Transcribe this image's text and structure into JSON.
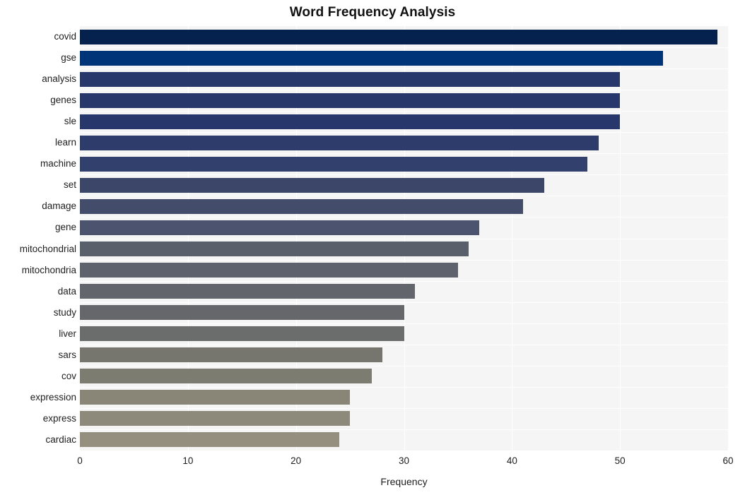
{
  "chart_data": {
    "type": "bar",
    "orientation": "horizontal",
    "title": "Word Frequency Analysis",
    "xlabel": "Frequency",
    "ylabel": "",
    "categories": [
      "covid",
      "gse",
      "analysis",
      "genes",
      "sle",
      "learn",
      "machine",
      "set",
      "damage",
      "gene",
      "mitochondrial",
      "mitochondria",
      "data",
      "study",
      "liver",
      "sars",
      "cov",
      "expression",
      "express",
      "cardiac"
    ],
    "values": [
      59,
      54,
      50,
      50,
      50,
      48,
      47,
      43,
      41,
      37,
      36,
      35,
      31,
      30,
      30,
      28,
      27,
      25,
      25,
      24
    ],
    "xlim": [
      0,
      60
    ],
    "xticks": [
      0,
      10,
      20,
      30,
      40,
      50,
      60
    ],
    "xtick_labels": [
      "0",
      "10",
      "20",
      "30",
      "40",
      "50",
      "60"
    ],
    "grid": true,
    "legend": false,
    "bar_colors": [
      "#04224d",
      "#003478",
      "#27376b",
      "#27376b",
      "#27376b",
      "#2d3c6b",
      "#32406d",
      "#3c4668",
      "#434c6b",
      "#4c536f",
      "#5a5f6c",
      "#5d626d",
      "#62656c",
      "#65676b",
      "#6b6d6d",
      "#76766f",
      "#7d7c71",
      "#8a8677",
      "#8d8a7c",
      "#948f7e"
    ],
    "plot_background": "#f5f5f6",
    "gridline_color": "#ffffff",
    "page_background": "#ffffff",
    "title_color": "#121212",
    "tick_label_color": "#1e1e1e"
  }
}
